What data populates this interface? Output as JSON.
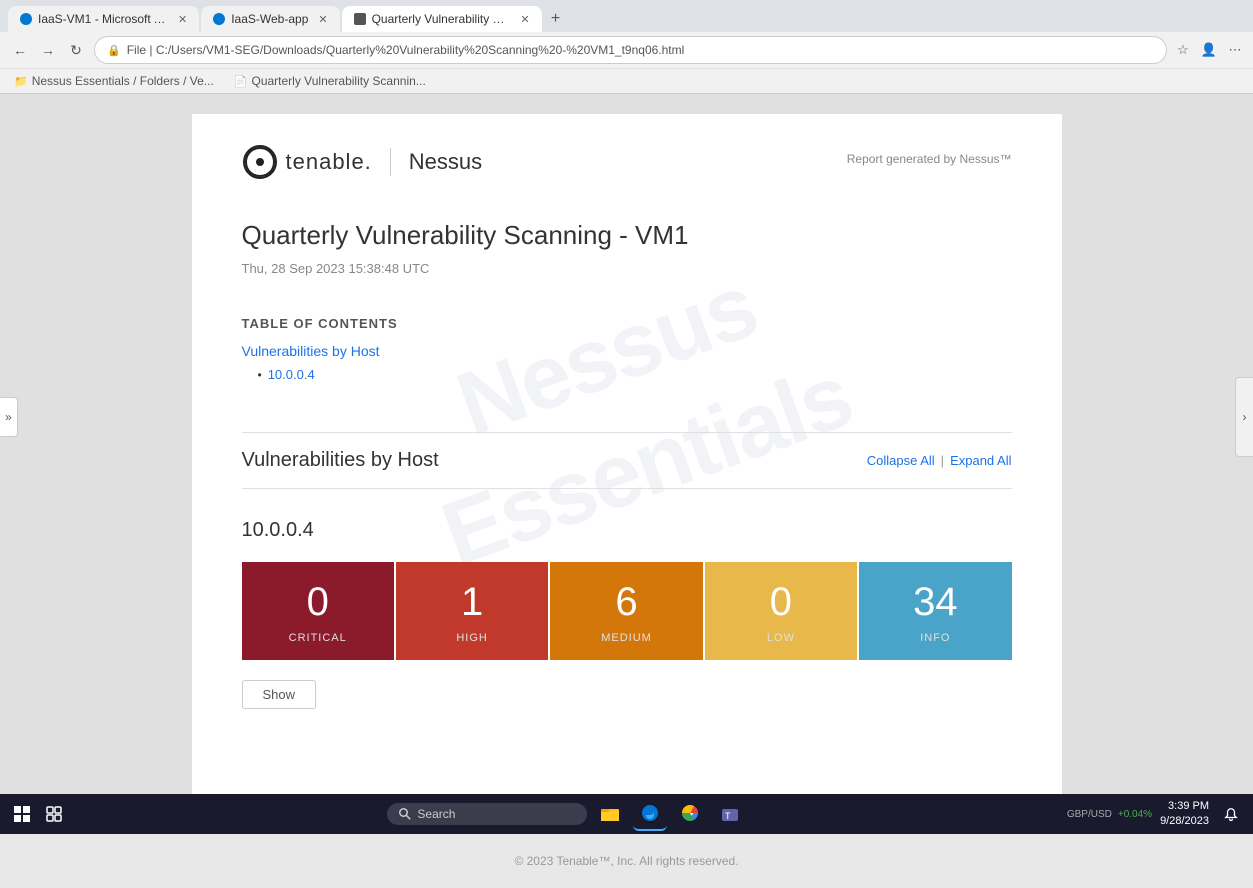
{
  "browser": {
    "tabs": [
      {
        "id": "tab1",
        "label": "IaaS-VM1 - Microsoft Azure",
        "active": false,
        "favicon": "azure"
      },
      {
        "id": "tab2",
        "label": "IaaS-Web-app",
        "active": false,
        "favicon": "azure"
      },
      {
        "id": "tab3",
        "label": "Quarterly Vulnerability Scannin...",
        "active": true,
        "favicon": "file"
      }
    ],
    "url": "C:/Users/VM1-SEG/Downloads/Quarterly%20Vulnerability%20Scanning%20-%20VM1_t9nq06.html",
    "display_url": "File  |  C:/Users/VM1-SEG/Downloads/Quarterly%20Vulnerability%20Scanning%20-%20VM1_t9nq06.html"
  },
  "favorites": [
    {
      "label": "Nessus Essentials / Folders / Ve..."
    },
    {
      "label": "Quarterly Vulnerability Scannin..."
    }
  ],
  "report": {
    "logo_text": "tenable.",
    "logo_product": "Nessus",
    "generated_by": "Report generated by Nessus™",
    "title": "Quarterly Vulnerability Scanning - VM1",
    "date": "Thu, 28 Sep 2023 15:38:48 UTC",
    "toc_heading": "TABLE OF CONTENTS",
    "toc_main_link": "Vulnerabilities by Host",
    "toc_sub_link": "10.0.0.4",
    "watermark_lines": [
      "Nessus",
      "Essentials"
    ],
    "section_title": "Vulnerabilities by Host",
    "collapse_all": "Collapse All",
    "separator": "|",
    "expand_all": "Expand All",
    "host_ip": "10.0.0.4",
    "severity_cards": [
      {
        "count": "0",
        "label": "CRITICAL",
        "color_class": "critical"
      },
      {
        "count": "1",
        "label": "HIGH",
        "color_class": "high"
      },
      {
        "count": "6",
        "label": "MEDIUM",
        "color_class": "medium"
      },
      {
        "count": "0",
        "label": "LOW",
        "color_class": "low"
      },
      {
        "count": "34",
        "label": "INFO",
        "color_class": "info"
      }
    ],
    "show_button": "Show"
  },
  "footer": {
    "text": "© 2023 Tenable™, Inc. All rights reserved."
  },
  "taskbar": {
    "search_placeholder": "Search",
    "clock_time": "3:39 PM",
    "clock_date": "9/28/2023",
    "currency": "GBP/USD",
    "currency_change": "+0.04%"
  }
}
